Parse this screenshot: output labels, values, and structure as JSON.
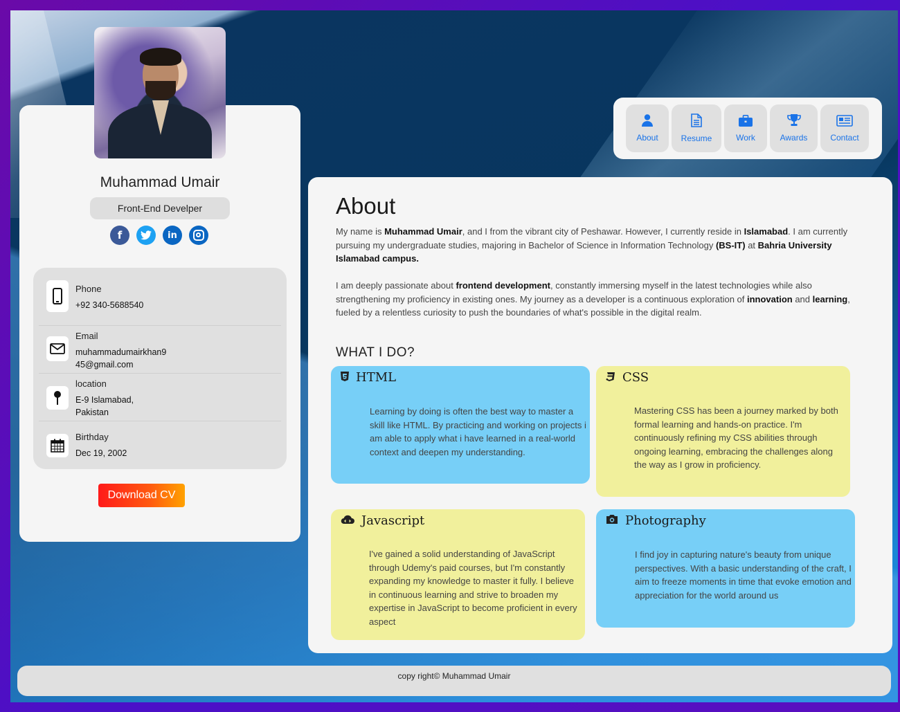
{
  "profile": {
    "name": "Muhammad Umair",
    "role": "Front-End Develper",
    "socials": [
      {
        "name": "facebook",
        "glyph": "f"
      },
      {
        "name": "twitter",
        "glyph": "t"
      },
      {
        "name": "linkedin",
        "glyph": "in"
      },
      {
        "name": "instagram",
        "glyph": ""
      }
    ],
    "contacts": {
      "phone_label": "Phone",
      "phone_value": "+92 340-5688540",
      "email_label": "Email",
      "email_value": "muhammadumairkhan945@gmail.com",
      "location_label": "location",
      "location_value": "E-9 Islamabad, Pakistan",
      "birthday_label": "Birthday",
      "birthday_value": "Dec 19, 2002"
    },
    "download_label": "Download CV"
  },
  "nav": {
    "about": "About",
    "resume": "Resume",
    "work": "Work",
    "awards": "Awards",
    "contact": "Contact"
  },
  "main": {
    "title": "About",
    "p1": {
      "t1": "My name is ",
      "b1": "Muhammad Umair",
      "t2": ", and I from the vibrant city of Peshawar. However, I currently reside in ",
      "b2": "Islamabad",
      "t3": ". I am currently pursuing my undergraduate studies, majoring in Bachelor of Science in Information Technology ",
      "b3": "(BS-IT)",
      "t4": " at ",
      "b4": "Bahria University Islamabad campus."
    },
    "p2": {
      "t1": "I am deeply passionate about ",
      "b1": "frontend development",
      "t2": ", constantly immersing myself in the latest technologies while also strengthening my proficiency in existing ones. My journey as a developer is a continuous exploration of ",
      "b2": "innovation",
      "t3": " and ",
      "b3": "learning",
      "t4": ", fueled by a relentless curiosity to push the boundaries of what's possible in the digital realm."
    },
    "whatido": "WHAT I DO?",
    "skills": {
      "html": {
        "title": "HTML",
        "body": "Learning by doing is often the best way to master a skill like HTML. By practicing and working on projects i am able to apply what i have learned in a real-world context and deepen my understanding."
      },
      "css": {
        "title": "CSS",
        "body": "Mastering CSS has been a journey marked by both formal learning and hands-on practice. I'm continuously refining my CSS abilities through ongoing learning, embracing the challenges along the way as I grow in proficiency."
      },
      "js": {
        "title": "Javascript",
        "body": "I've gained a solid understanding of JavaScript through Udemy's paid courses, but I'm constantly expanding my knowledge to master it fully. I believe in continuous learning and strive to broaden my expertise in JavaScript to become proficient in every aspect"
      },
      "photo": {
        "title": "Photography",
        "body": "I find joy in capturing nature's beauty from unique perspectives. With a basic understanding of the craft, I aim to freeze moments in time that evoke emotion and appreciation for the world around us"
      }
    }
  },
  "footer": {
    "text": "copy right© Muhammad Umair"
  },
  "colors": {
    "accent": "#1a73e8",
    "card_blue": "#77cff7",
    "card_yellow": "#f1f09c",
    "download_start": "#ff1a1a",
    "download_end": "#ffa200"
  }
}
